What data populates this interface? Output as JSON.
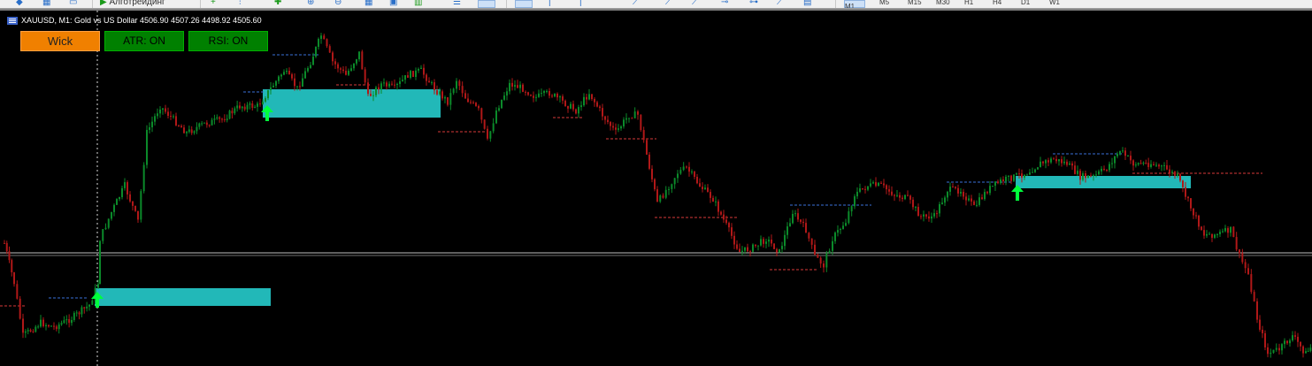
{
  "toolbar": {
    "algo_label": "Алготрейдинг",
    "timeframes": [
      "M1",
      "M5",
      "M15",
      "M30",
      "H1",
      "H4",
      "D1",
      "W1"
    ]
  },
  "chart": {
    "symbol_line": "XAUUSD, M1:  Gold vs US Dollar  4506.90 4507.26 4498.92 4505.60",
    "background": "#000000",
    "bull_color": "#0b8a2a",
    "bear_color": "#b01818",
    "zone_color": "#22b8b8",
    "arrow_color": "#00ff3c",
    "high_line_color": "#3a6fd8",
    "low_line_color": "#d83a3a"
  },
  "buttons": {
    "wick": "Wick",
    "atr": "ATR: ON",
    "rsi": "RSI: ON"
  }
}
